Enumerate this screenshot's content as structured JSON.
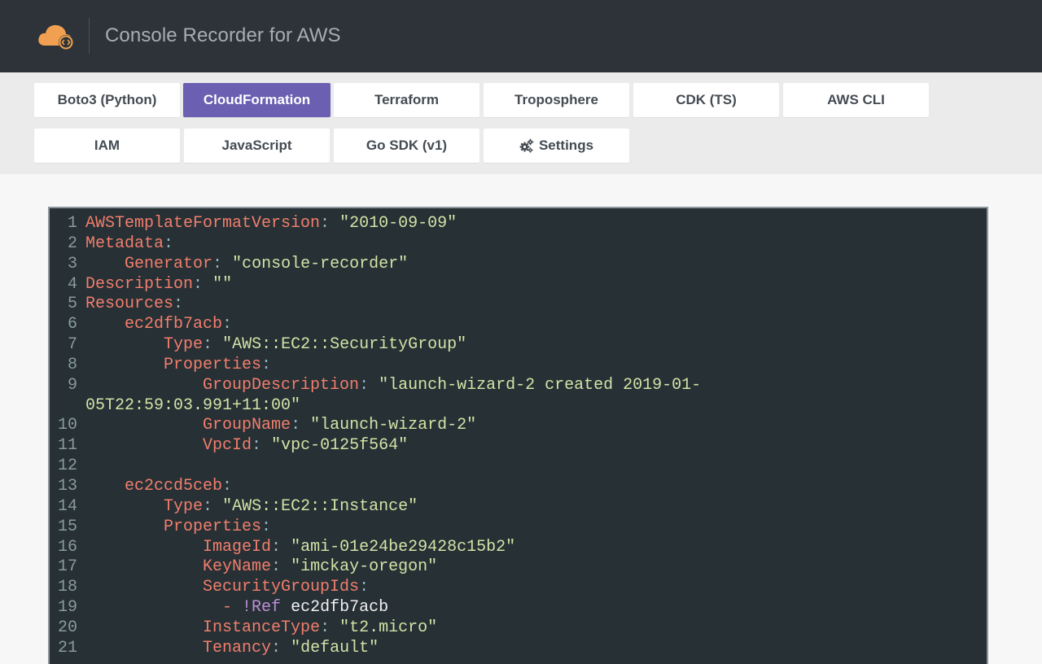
{
  "app": {
    "title": "Console Recorder for AWS"
  },
  "tabs": [
    {
      "label": "Boto3 (Python)",
      "active": false
    },
    {
      "label": "CloudFormation",
      "active": true
    },
    {
      "label": "Terraform",
      "active": false
    },
    {
      "label": "Troposphere",
      "active": false
    },
    {
      "label": "CDK (TS)",
      "active": false
    },
    {
      "label": "AWS CLI",
      "active": false
    },
    {
      "label": "IAM",
      "active": false
    },
    {
      "label": "JavaScript",
      "active": false
    },
    {
      "label": "Go SDK (v1)",
      "active": false
    },
    {
      "label": "Settings",
      "active": false,
      "icon": "gears-icon"
    }
  ],
  "colors": {
    "header_bg": "#2d3338",
    "accent": "#6a5fb0",
    "code_bg": "#263035",
    "key": "#f27e6c",
    "string": "#d2e3a6",
    "tag": "#c08ed8",
    "logo": "#f0a050"
  },
  "code": {
    "language": "yaml",
    "lines": [
      {
        "n": "1",
        "indent": "",
        "key": "AWSTemplateFormatVersion",
        "value": "\"2010-09-09\""
      },
      {
        "n": "2",
        "indent": "",
        "key": "Metadata",
        "value": ""
      },
      {
        "n": "3",
        "indent": "    ",
        "key": "Generator",
        "value": "\"console-recorder\""
      },
      {
        "n": "4",
        "indent": "",
        "key": "Description",
        "value": "\"\""
      },
      {
        "n": "5",
        "indent": "",
        "key": "Resources",
        "value": ""
      },
      {
        "n": "6",
        "indent": "    ",
        "key": "ec2dfb7acb",
        "value": ""
      },
      {
        "n": "7",
        "indent": "        ",
        "key": "Type",
        "value": "\"AWS::EC2::SecurityGroup\""
      },
      {
        "n": "8",
        "indent": "        ",
        "key": "Properties",
        "value": ""
      },
      {
        "n": "9",
        "indent": "            ",
        "key": "GroupDescription",
        "value": "\"launch-wizard-2 created 2019-01-"
      },
      {
        "n": "",
        "indent": "",
        "key": "",
        "value": "05T22:59:03.991+11:00\""
      },
      {
        "n": "10",
        "indent": "            ",
        "key": "GroupName",
        "value": "\"launch-wizard-2\""
      },
      {
        "n": "11",
        "indent": "            ",
        "key": "VpcId",
        "value": "\"vpc-0125f564\""
      },
      {
        "n": "12",
        "indent": "",
        "key": "",
        "value": ""
      },
      {
        "n": "13",
        "indent": "    ",
        "key": "ec2ccd5ceb",
        "value": ""
      },
      {
        "n": "14",
        "indent": "        ",
        "key": "Type",
        "value": "\"AWS::EC2::Instance\""
      },
      {
        "n": "15",
        "indent": "        ",
        "key": "Properties",
        "value": ""
      },
      {
        "n": "16",
        "indent": "            ",
        "key": "ImageId",
        "value": "\"ami-01e24be29428c15b2\""
      },
      {
        "n": "17",
        "indent": "            ",
        "key": "KeyName",
        "value": "\"imckay-oregon\""
      },
      {
        "n": "18",
        "indent": "            ",
        "key": "SecurityGroupIds",
        "value": ""
      },
      {
        "n": "19",
        "indent": "              ",
        "dash": "- ",
        "tag": "!Ref",
        "plain": " ec2dfb7acb"
      },
      {
        "n": "20",
        "indent": "            ",
        "key": "InstanceType",
        "value": "\"t2.micro\""
      },
      {
        "n": "21",
        "indent": "            ",
        "key": "Tenancy",
        "value": "\"default\""
      }
    ]
  }
}
